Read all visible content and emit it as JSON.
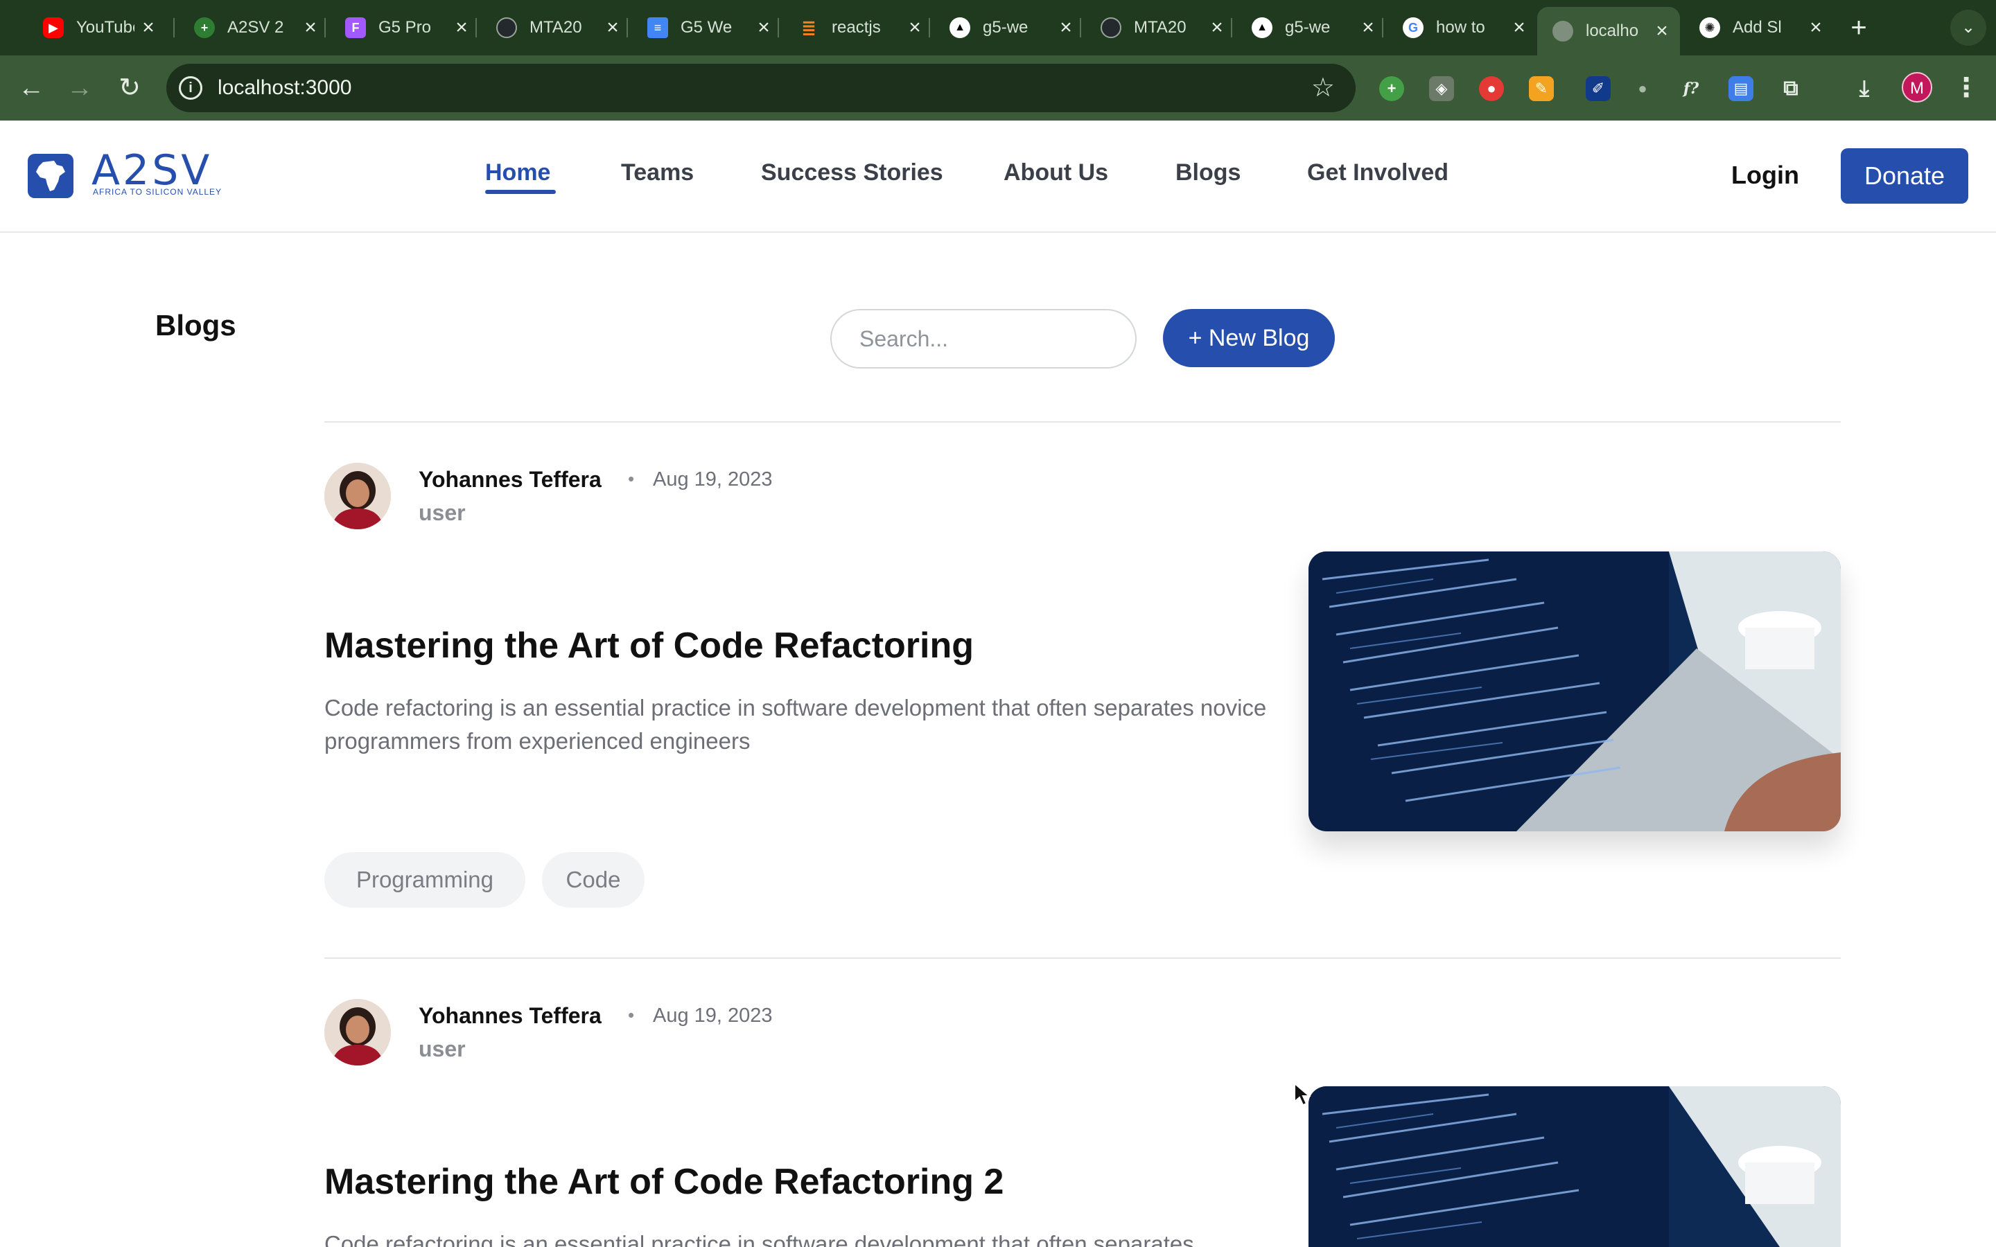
{
  "browser": {
    "tabs": [
      {
        "title": "YouTube",
        "icon": "youtube-icon",
        "color": "#ff0000"
      },
      {
        "title": "A2SV 2",
        "icon": "a2sv-icon",
        "color": "#2e7d32"
      },
      {
        "title": "G5 Pro",
        "icon": "figma-icon",
        "color": "#a259ff"
      },
      {
        "title": "MTA20",
        "icon": "github-icon",
        "color": "#24292e"
      },
      {
        "title": "G5 We",
        "icon": "google-docs-icon",
        "color": "#4285f4"
      },
      {
        "title": "reactjs",
        "icon": "stackoverflow-icon",
        "color": "#f48024"
      },
      {
        "title": "g5-we",
        "icon": "vercel-icon",
        "color": "#000000"
      },
      {
        "title": "MTA20",
        "icon": "github-icon",
        "color": "#24292e"
      },
      {
        "title": "g5-we",
        "icon": "vercel-icon",
        "color": "#000000"
      },
      {
        "title": "how to",
        "icon": "google-icon",
        "color": "#ffffff"
      },
      {
        "title": "localho",
        "icon": "globe-icon",
        "color": "#8a9a88"
      },
      {
        "title": "Add Sl",
        "icon": "openai-icon",
        "color": "#ffffff"
      }
    ],
    "url": "localhost:3000",
    "profile_initial": "M"
  },
  "site": {
    "brand_name": "A2SV",
    "brand_tagline": "AFRICA TO SILICON VALLEY",
    "nav": [
      "Home",
      "Teams",
      "Success Stories",
      "About Us",
      "Blogs",
      "Get Involved"
    ],
    "active_nav": "Home",
    "login": "Login",
    "donate": "Donate",
    "accent_color": "#264fad"
  },
  "blogs": {
    "heading": "Blogs",
    "search_placeholder": "Search...",
    "new_blog_label": "+ New Blog",
    "posts": [
      {
        "author": "Yohannes Teffera",
        "date": "Aug 19, 2023",
        "role": "user",
        "title": "Mastering the Art of Code Refactoring",
        "excerpt": "Code refactoring is an essential practice in software development that often separates novice programmers from experienced engineers",
        "tags": [
          "Programming",
          "Code"
        ]
      },
      {
        "author": "Yohannes Teffera",
        "date": "Aug 19, 2023",
        "role": "user",
        "title": "Mastering the Art of Code Refactoring 2",
        "excerpt": "Code refactoring is an essential practice in software development that often separates"
      }
    ]
  }
}
